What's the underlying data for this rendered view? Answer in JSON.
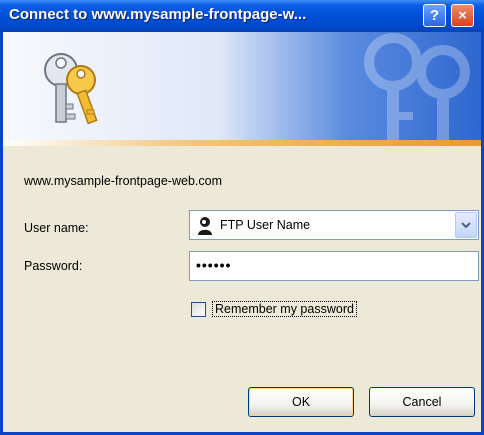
{
  "window": {
    "title": "Connect to www.mysample-frontpage-w...",
    "help_label": "?",
    "close_label": "×"
  },
  "dialog": {
    "server": "www.mysample-frontpage-web.com",
    "username_label": "User name:",
    "username_value": "FTP User Name",
    "password_label": "Password:",
    "password_value": "••••••",
    "remember_label": "Remember my password",
    "remember_checked": false,
    "ok_label": "OK",
    "cancel_label": "Cancel"
  },
  "icons": {
    "banner": "keys-icon",
    "user": "user-icon",
    "dropdown": "chevron-down-icon"
  },
  "colors": {
    "titlebar": "#0250d8",
    "dialog_bg": "#ece9d8",
    "banner_accent": "#e89a2a"
  }
}
